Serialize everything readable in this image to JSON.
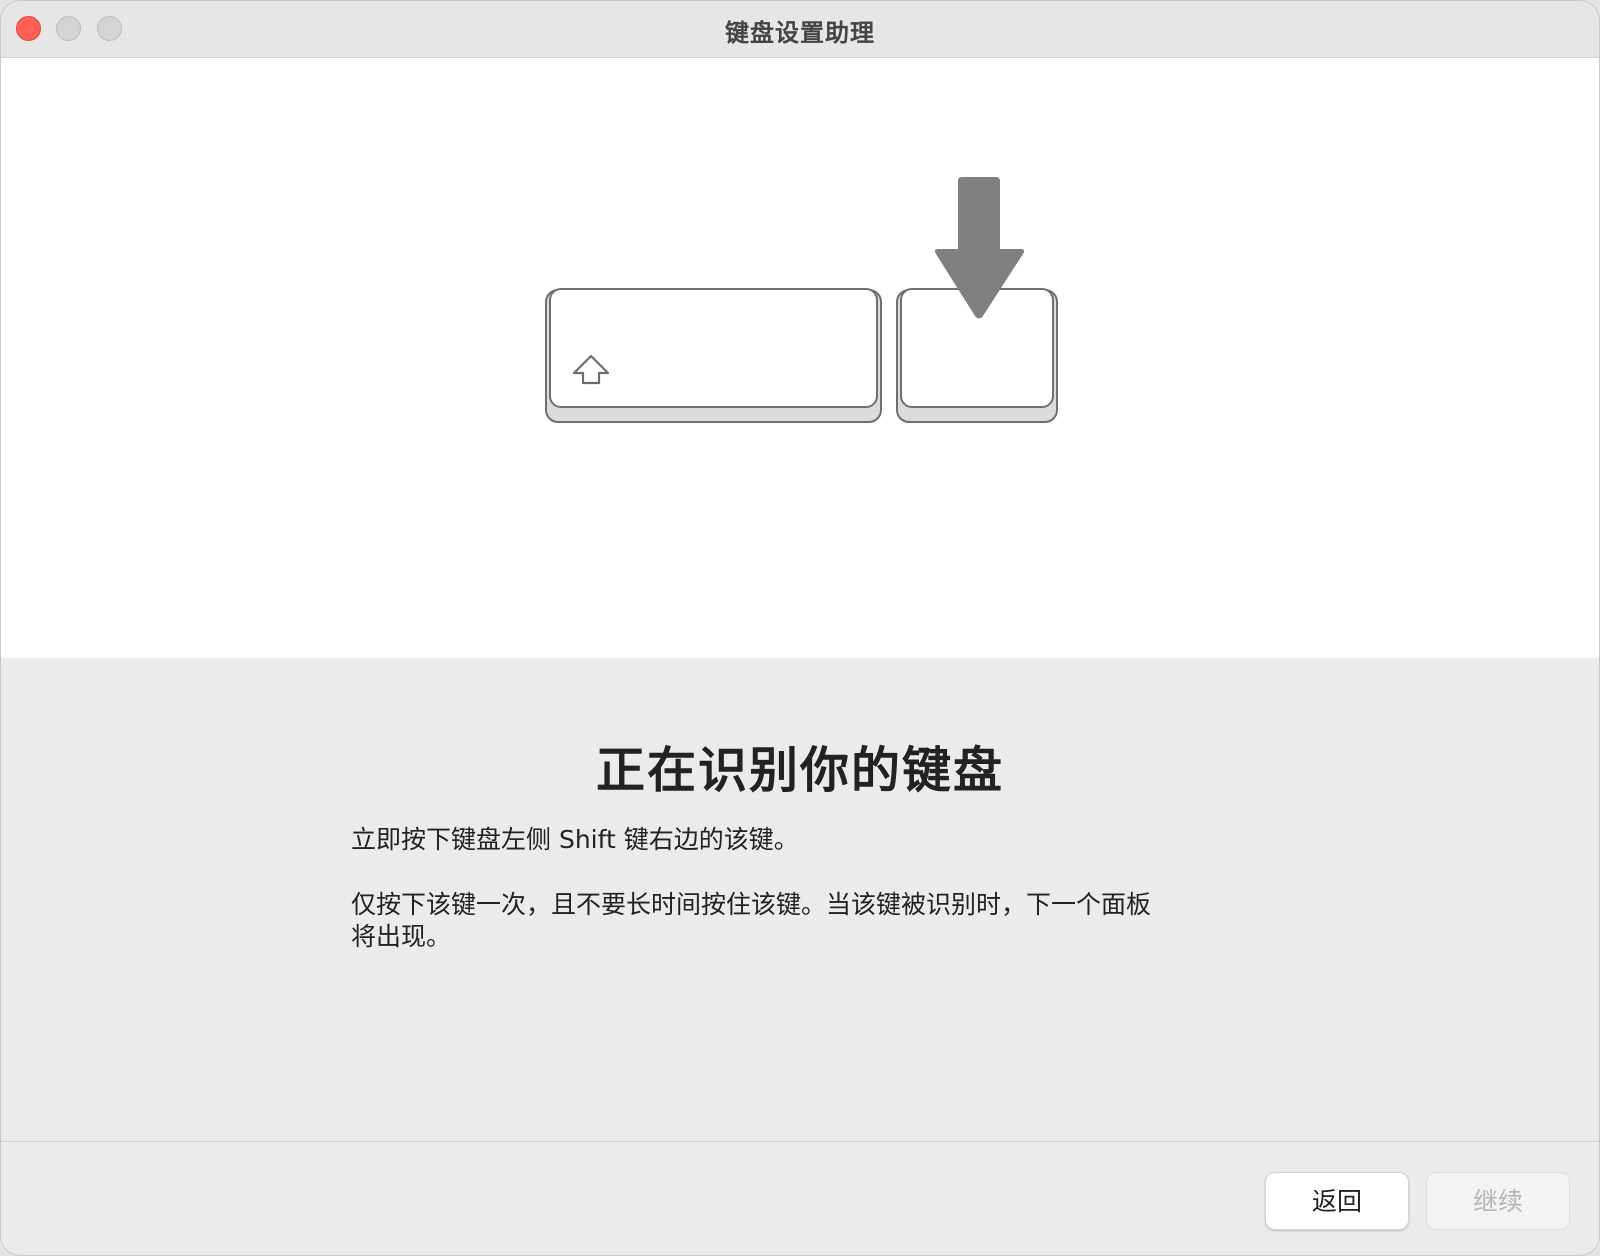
{
  "window": {
    "title": "键盘设置助理"
  },
  "illustration": {
    "left_key_icon": "shift-arrow-icon",
    "arrow_icon": "down-arrow-icon"
  },
  "main": {
    "heading": "正在识别你的键盘",
    "instruction_1": "立即按下键盘左侧 Shift 键右边的该键。",
    "instruction_2": "仅按下该键一次，且不要长时间按住该键。当该键被识别时，下一个面板将出现。"
  },
  "footer": {
    "back_label": "返回",
    "continue_label": "继续"
  },
  "colors": {
    "close": "#fe5f57",
    "arrow": "#808080",
    "disabled_text": "#b5b5b5"
  }
}
